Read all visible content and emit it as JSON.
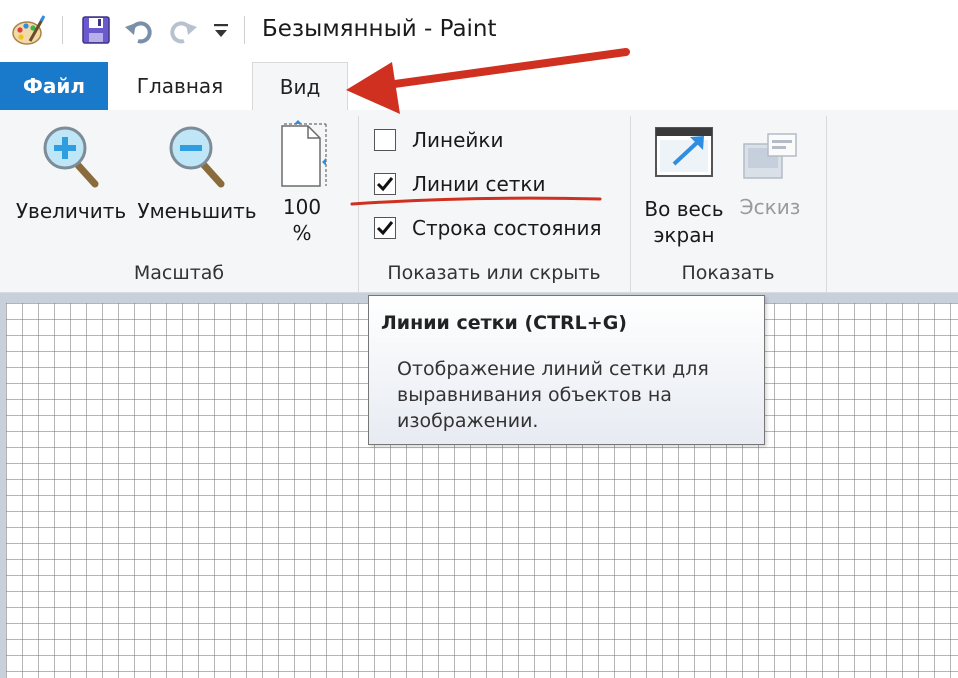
{
  "window": {
    "title": "Безымянный - Paint"
  },
  "quick_access": {
    "icons": [
      "paint-app-icon",
      "save-icon",
      "undo-icon",
      "redo-icon",
      "customize-dropdown-icon"
    ]
  },
  "tabs": {
    "file": "Файл",
    "home": "Главная",
    "view": "Вид",
    "active": "Вид"
  },
  "ribbon": {
    "zoom_group": {
      "label": "Масштаб",
      "zoom_in": "Увеличить",
      "zoom_out": "Уменьшить",
      "hundred_line1": "100",
      "hundred_line2": "%"
    },
    "show_hide_group": {
      "label": "Показать или скрыть",
      "rulers": {
        "label": "Линейки",
        "checked": false
      },
      "gridlines": {
        "label": "Линии сетки",
        "checked": true
      },
      "status_bar": {
        "label": "Строка состояния",
        "checked": true
      }
    },
    "display_group": {
      "label": "Показать",
      "fullscreen_line1": "Во весь",
      "fullscreen_line2": "экран",
      "thumbnail": "Эскиз",
      "thumbnail_enabled": false
    }
  },
  "tooltip": {
    "title": "Линии сетки (CTRL+G)",
    "description": "Отображение линий сетки для выравнивания объектов на изображении."
  },
  "colors": {
    "file_tab": "#1979ca",
    "ribbon_bg": "#f5f6f7",
    "canvas_bg": "#c8d0dc",
    "annotation_red": "#d0301f"
  }
}
